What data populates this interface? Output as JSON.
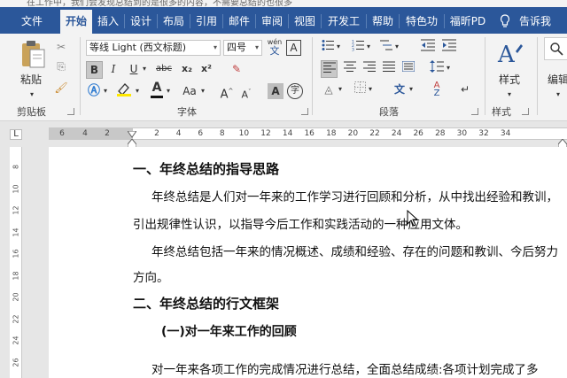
{
  "tabs": [
    {
      "label": "文件",
      "active": false
    },
    {
      "label": "开始",
      "active": true
    },
    {
      "label": "插入",
      "active": false
    },
    {
      "label": "设计",
      "active": false
    },
    {
      "label": "布局",
      "active": false
    },
    {
      "label": "引用",
      "active": false
    },
    {
      "label": "邮件",
      "active": false
    },
    {
      "label": "审阅",
      "active": false
    },
    {
      "label": "视图",
      "active": false
    },
    {
      "label": "开发工",
      "active": false
    },
    {
      "label": "帮助",
      "active": false
    },
    {
      "label": "特色功",
      "active": false
    },
    {
      "label": "福昕PD",
      "active": false
    },
    {
      "label": "告诉我",
      "active": false
    }
  ],
  "ribbon": {
    "clipboard": {
      "label": "剪贴板",
      "paste": "粘贴"
    },
    "font": {
      "label": "字体",
      "font_name": "等线 Light (西文标题)",
      "font_size": "四号",
      "bold": "B",
      "italic": "I",
      "underline": "U",
      "strike": "abc",
      "sub": "x₂",
      "sup": "x²",
      "aa": "Aa",
      "grow": "A",
      "shrink": "A",
      "clear": "A",
      "phonetic": "wén",
      "charborder": "A",
      "enclose": "字"
    },
    "paragraph": {
      "label": "段落"
    },
    "styles": {
      "label": "样式",
      "button": "样式"
    },
    "editing": {
      "label": "编辑"
    }
  },
  "ruler": {
    "corner": "L",
    "numbers": [
      "6",
      "4",
      "2",
      "2",
      "4",
      "6",
      "8",
      "10",
      "12",
      "14",
      "16",
      "18",
      "20",
      "22",
      "24",
      "26",
      "28",
      "30",
      "32",
      "34"
    ]
  },
  "vruler": {
    "numbers": [
      "8",
      "10",
      "12",
      "14",
      "16",
      "18",
      "20",
      "22",
      "24",
      "26",
      "28"
    ]
  },
  "document": {
    "heading1": "一、年终总结的指导思路",
    "para1_line1": "年终总结是人们对一年来的工作学习进行回顾和分析，从中找出经验和教训，",
    "para1_line2": "引出规律性认识，以指导今后工作和实践活动的一种应用文体。",
    "para2_line1": "年终总结包括一年来的情况概述、成绩和经验、存在的问题和教训、今后努力",
    "para2_line2": "方向。",
    "heading2": "二、年终总结的行文框架",
    "heading3": "(一)对一年来工作的回顾",
    "para3_line1": "对一年来各项工作的完成情况进行总结，全面总结成绩:各项计划完成了多"
  },
  "colors": {
    "accent": "#2b579a"
  },
  "top_sliver": "在工作中，我们会发现总结到的是很多的内容，不需要总结的也很多"
}
